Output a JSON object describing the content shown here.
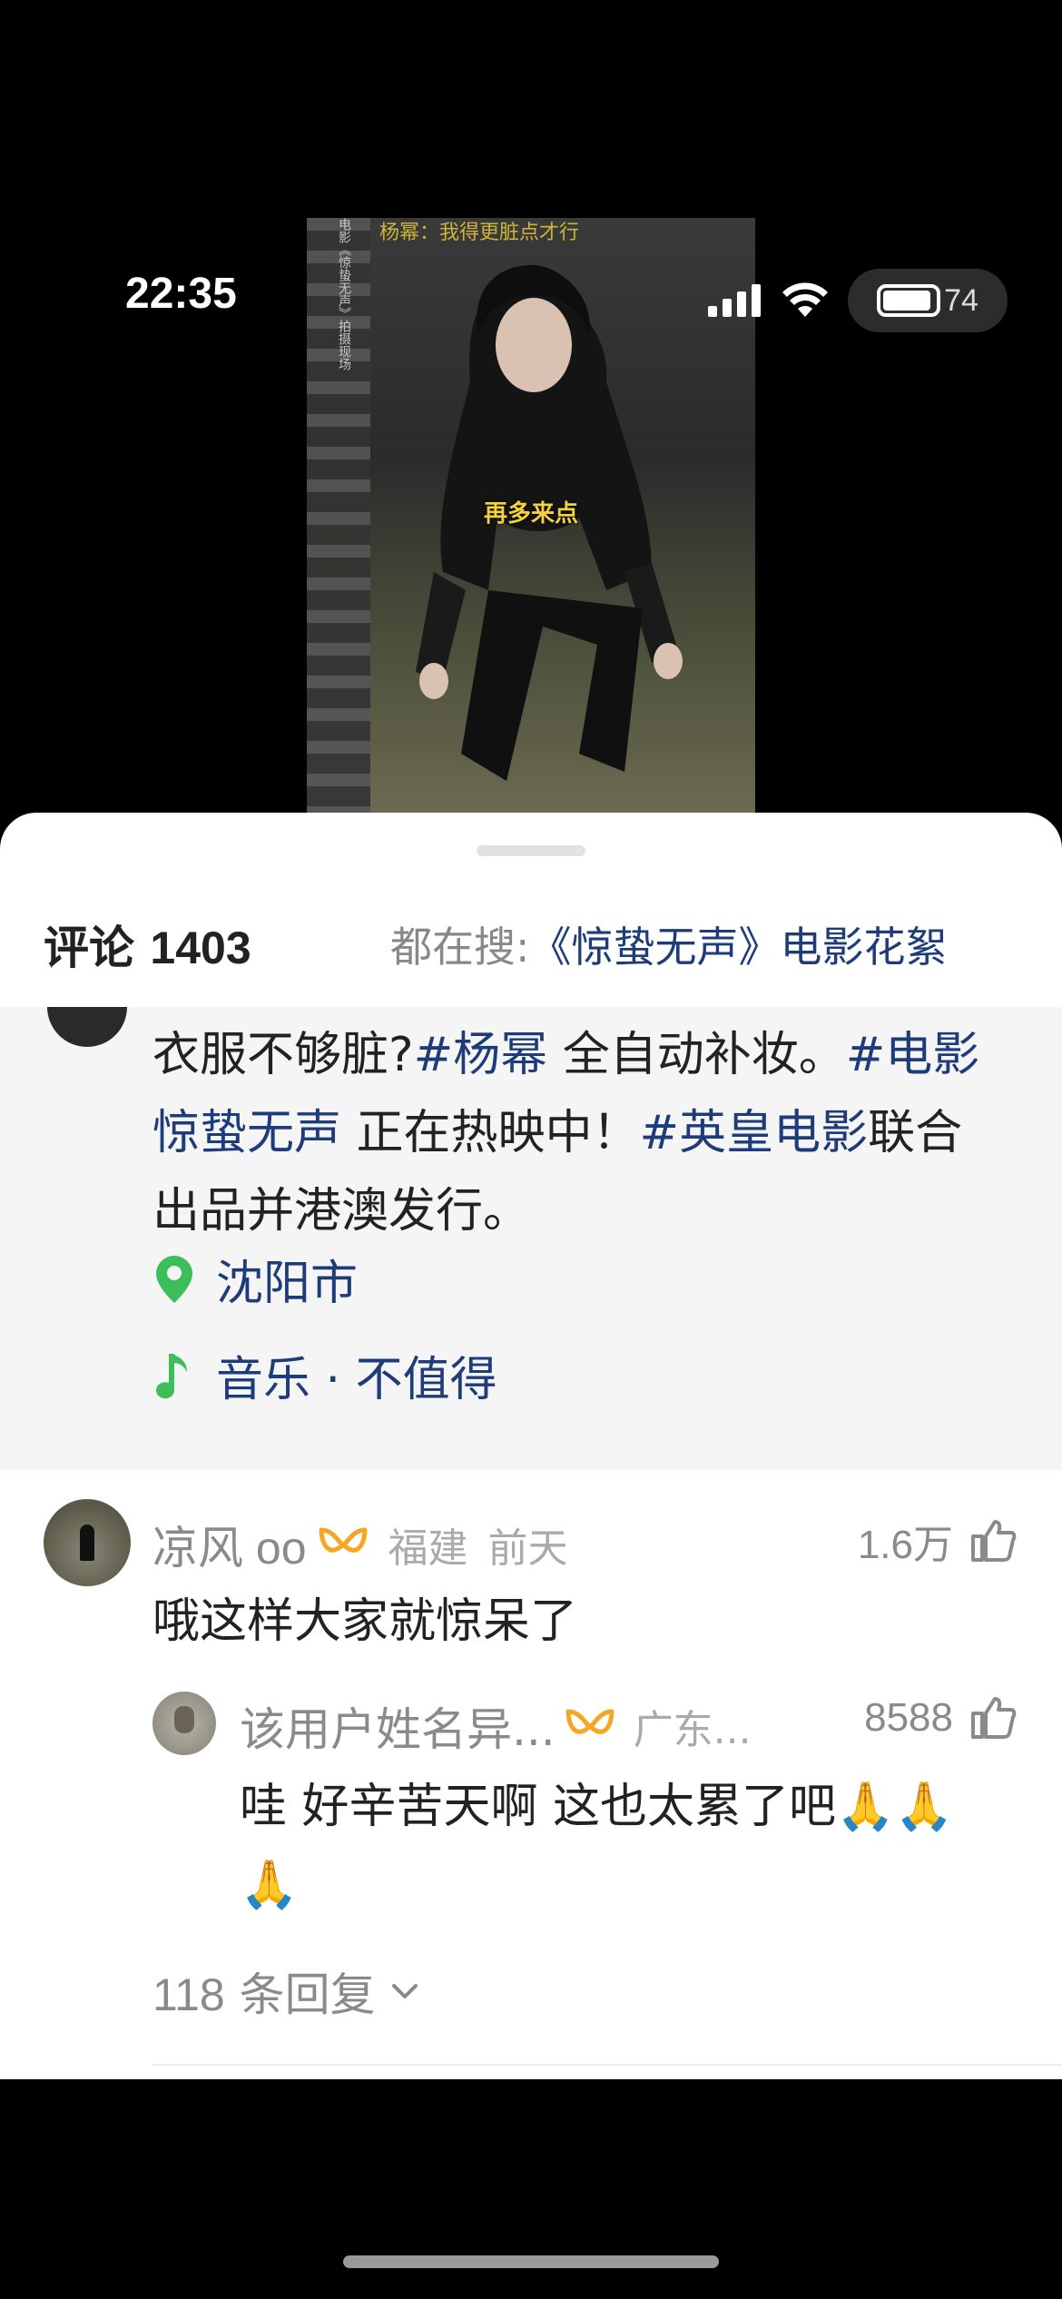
{
  "status_bar": {
    "time": "22:35",
    "battery": "74"
  },
  "video": {
    "caption": "再多来点",
    "side_text": "电影《惊蛰无声》拍摄现场",
    "top_text": "杨幂：我得更脏点才行"
  },
  "sheet": {
    "comments_label": "评论",
    "comments_count": "1403",
    "search_prefix": "都在搜:",
    "search_query": "《惊蛰无声》电影花絮"
  },
  "description": {
    "part1": "衣服不够脏?",
    "tag1": "#杨幂",
    "part2": " 全自动补妆。",
    "tag2": "#电影惊蛰无声",
    "part3": " 正在热映中！",
    "tag3": "#英皇电影",
    "part4": "联合出品并港澳发行。",
    "location": "沈阳市",
    "music": "音乐 · 不值得"
  },
  "comments": [
    {
      "name": "凉风 oo",
      "region": "福建",
      "time": "前天",
      "likes": "1.6万",
      "text": "哦这样大家就惊呆了"
    },
    {
      "name": "该用户姓名异...",
      "region": "广东...",
      "likes": "8588",
      "text": "哇 好辛苦天啊 这也太累了吧🙏🙏🙏"
    }
  ],
  "more_replies": {
    "count": "118",
    "label": "条回复"
  },
  "colors": {
    "link": "#1e3c7a",
    "badge": "#f5a623",
    "location_pin": "#3dbd5c"
  }
}
